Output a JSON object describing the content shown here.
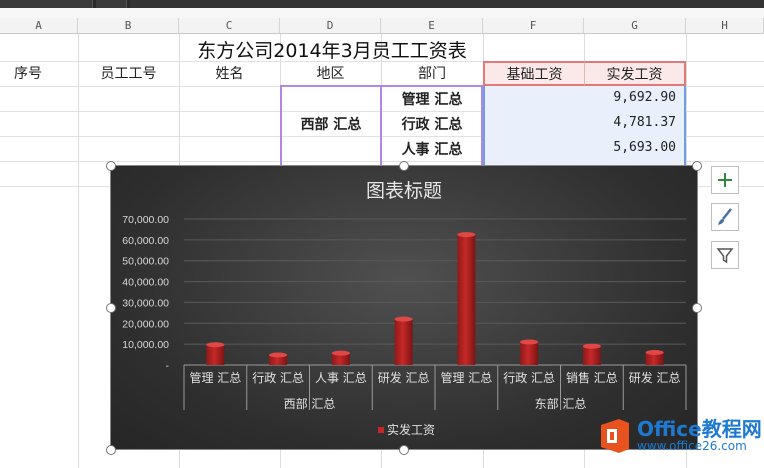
{
  "columns": [
    "A",
    "B",
    "C",
    "D",
    "E",
    "F",
    "G",
    "H"
  ],
  "sheet": {
    "title": "东方公司2014年3月员工工资表",
    "headers": [
      "序号",
      "员工工号",
      "姓名",
      "地区",
      "部门",
      "基础工资",
      "实发工资"
    ],
    "region_group": "西部 汇总",
    "rows": [
      {
        "dept": "管理 汇总",
        "salary": "9,692.90"
      },
      {
        "dept": "行政 汇总",
        "salary": "4,781.37"
      },
      {
        "dept": "人事 汇总",
        "salary": "5,693.00"
      }
    ]
  },
  "chart_data": {
    "type": "bar",
    "title": "图表标题",
    "categories": [
      "管理 汇总",
      "行政 汇总",
      "人事 汇总",
      "研发 汇总",
      "管理 汇总",
      "行政 汇总",
      "销售 汇总",
      "研发 汇总"
    ],
    "groups": [
      {
        "label": "西部 汇总",
        "count": 4
      },
      {
        "label": "东部 汇总",
        "count": 4
      }
    ],
    "series": [
      {
        "name": "实发工资",
        "values": [
          9692.9,
          4781.37,
          5693.0,
          22000,
          62500,
          11000,
          9000,
          6000
        ]
      }
    ],
    "ylim": [
      0,
      70000
    ],
    "yticks": [
      "-",
      "10,000.00",
      "20,000.00",
      "30,000.00",
      "40,000.00",
      "50,000.00",
      "60,000.00",
      "70,000.00"
    ],
    "grid": true,
    "legend": "bottom",
    "bar_color": "#c62828"
  },
  "watermark": {
    "text": "Office教程网",
    "url": "www.office26.com"
  }
}
